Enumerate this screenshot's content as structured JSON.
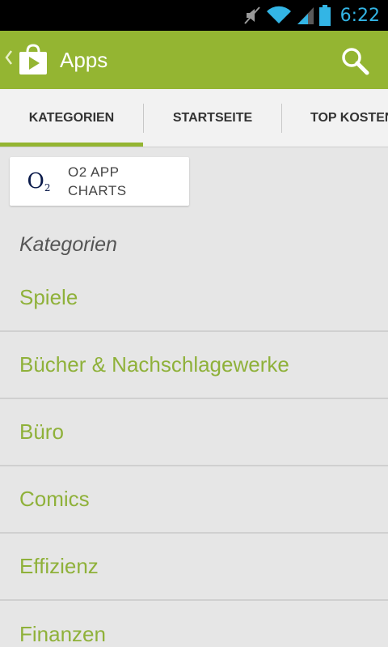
{
  "status_bar": {
    "time": "6:22",
    "icons": [
      "mute-icon",
      "wifi-icon",
      "signal-icon",
      "battery-icon"
    ],
    "time_color": "#33b5e5"
  },
  "action_bar": {
    "title": "Apps",
    "background": "#94b532",
    "icons": [
      "up-caret-icon",
      "play-store-icon",
      "search-icon"
    ]
  },
  "tabs": [
    {
      "label": "KATEGORIEN",
      "selected": true
    },
    {
      "label": "STARTSEITE",
      "selected": false
    },
    {
      "label": "TOP KOSTEN",
      "selected": false
    }
  ],
  "promo_card": {
    "logo_text": "O",
    "logo_subscript": "2",
    "line1": "O2 APP",
    "line2": "CHARTS"
  },
  "section": {
    "heading": "Kategorien"
  },
  "categories": [
    {
      "label": "Spiele"
    },
    {
      "label": "Bücher & Nachschlagewerke"
    },
    {
      "label": "Büro"
    },
    {
      "label": "Comics"
    },
    {
      "label": "Effizienz"
    },
    {
      "label": "Finanzen"
    }
  ],
  "colors": {
    "accent": "#94b532",
    "category_text": "#8fb13a",
    "background": "#e6e6e6"
  }
}
